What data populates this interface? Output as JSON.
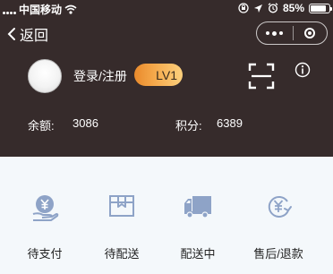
{
  "status_bar": {
    "carrier": "中国移动",
    "battery": "85%",
    "battery_level": 0.85
  },
  "nav": {
    "back_label": "返回"
  },
  "profile": {
    "login_label": "登录/注册",
    "level_label": "LV1"
  },
  "stats": {
    "balance_label": "余额:",
    "balance_value": "3086",
    "points_label": "积分:",
    "points_value": "6389"
  },
  "orders": [
    {
      "label": "待支付",
      "icon": "payment-icon"
    },
    {
      "label": "待配送",
      "icon": "package-icon"
    },
    {
      "label": "配送中",
      "icon": "truck-icon"
    },
    {
      "label": "售后/退款",
      "icon": "refund-icon"
    }
  ],
  "colors": {
    "header_bg": "#362b2b",
    "icon_blue": "#8ea3c7",
    "level_orange": "#f5a84a"
  }
}
